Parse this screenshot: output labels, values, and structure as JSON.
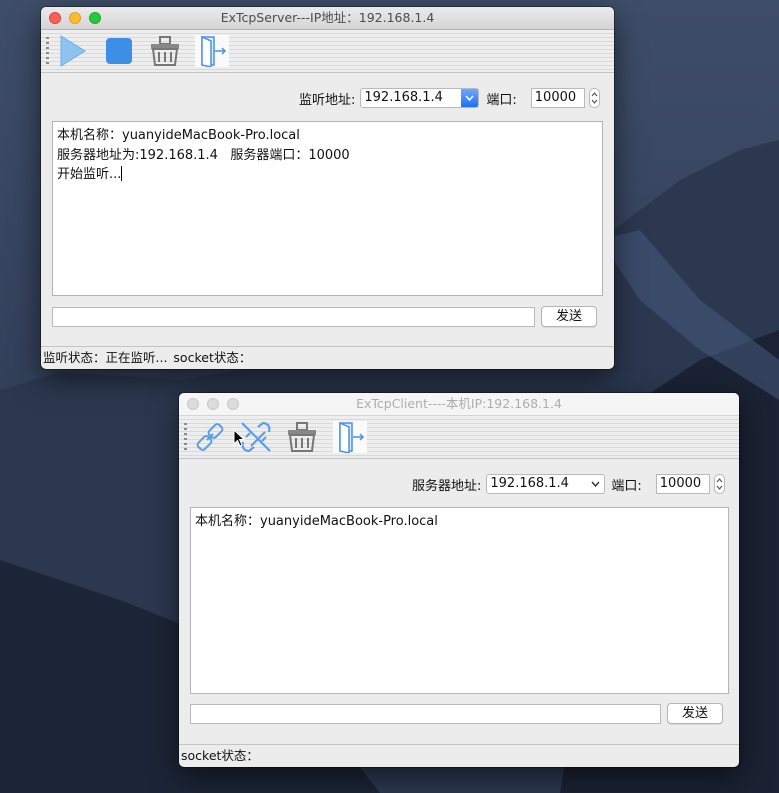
{
  "colors": {
    "desktop_sky": "#33415a",
    "mountain": "#1d2739",
    "accent_blue": "#4a90e2"
  },
  "server": {
    "title": "ExTcpServer---IP地址：192.168.1.4",
    "toolbar": [
      "play-icon",
      "stop-icon",
      "clear-basket-icon",
      "exit-door-icon"
    ],
    "listen_label": "监听地址:",
    "listen_value": "192.168.1.4",
    "port_label": "端口:",
    "port_value": "10000",
    "log": {
      "line1": "本机名称：yuanyideMacBook-Pro.local",
      "line2": "服务器地址为:192.168.1.4   服务器端口：10000",
      "line3": "开始监听..."
    },
    "send_input_value": "",
    "send_label": "发送",
    "status": {
      "listen_status": "监听状态：正在监听...",
      "socket_status": "socket状态："
    }
  },
  "client": {
    "title": "ExTcpClient----本机IP:192.168.1.4",
    "toolbar": [
      "connect-icon",
      "disconnect-icon",
      "clear-basket-icon",
      "exit-door-icon"
    ],
    "server_label": "服务器地址:",
    "server_value": "192.168.1.4",
    "port_label": "端口:",
    "port_value": "10000",
    "log": {
      "line1": "本机名称：yuanyideMacBook-Pro.local"
    },
    "send_input_value": "",
    "send_label": "发送",
    "status": {
      "socket_status": "socket状态："
    }
  }
}
